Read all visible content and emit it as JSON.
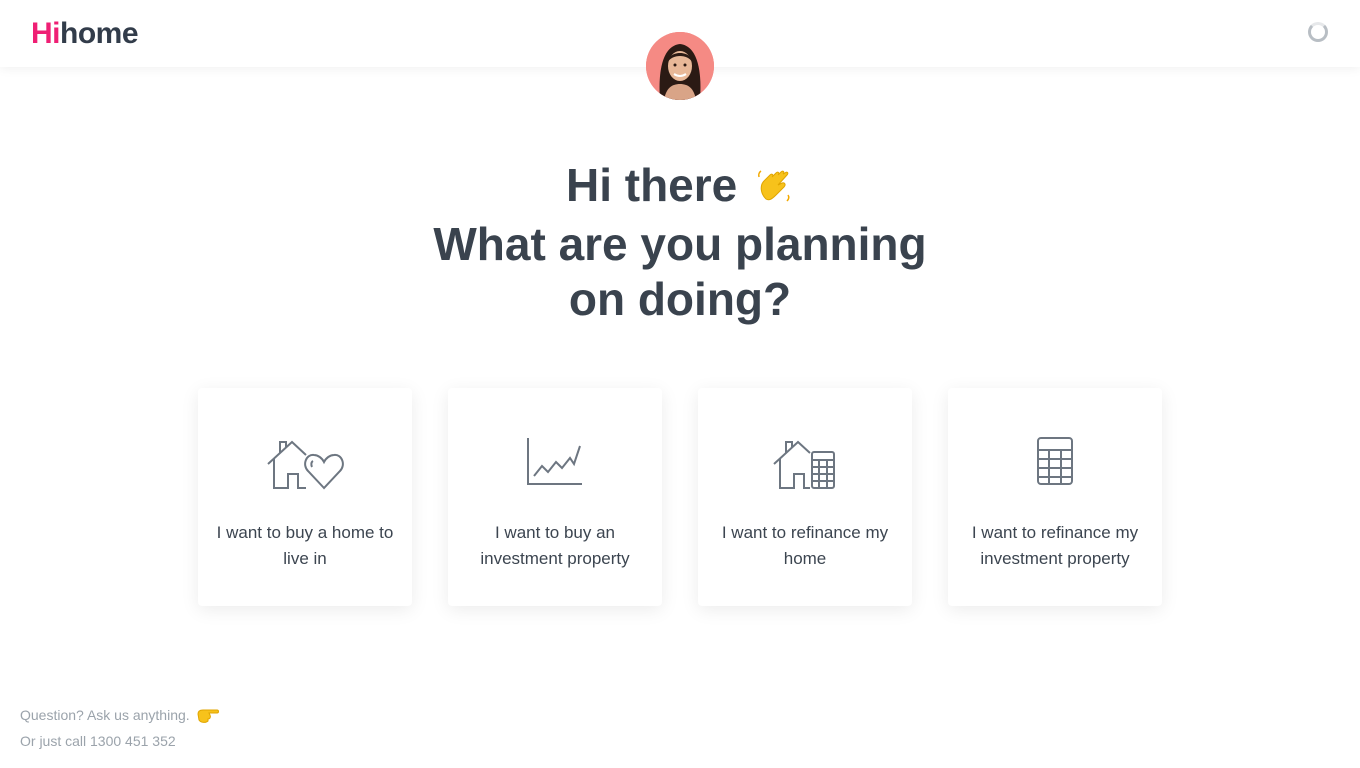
{
  "header": {
    "logo_hi": "Hi",
    "logo_home": "home",
    "brand_color": "#ef1f74",
    "spinner_icon": "loading-spinner-icon"
  },
  "advisor": {
    "icon": "advisor-avatar"
  },
  "main": {
    "greeting": "Hi there",
    "greeting_icon": "waving-hand-icon",
    "question_line1": "What are you planning",
    "question_line2": "on doing?"
  },
  "options": [
    {
      "label": "I want to buy a home to live in",
      "icon": "house-heart-icon"
    },
    {
      "label": "I want to buy an investment property",
      "icon": "line-chart-icon"
    },
    {
      "label": "I want to refinance my home",
      "icon": "house-calculator-icon"
    },
    {
      "label": "I want to refinance my investment property",
      "icon": "calculator-icon"
    }
  ],
  "footer": {
    "question": "Question? Ask us anything.",
    "pointer_icon": "pointing-hand-icon",
    "call": "Or just call 1300 451 352"
  }
}
